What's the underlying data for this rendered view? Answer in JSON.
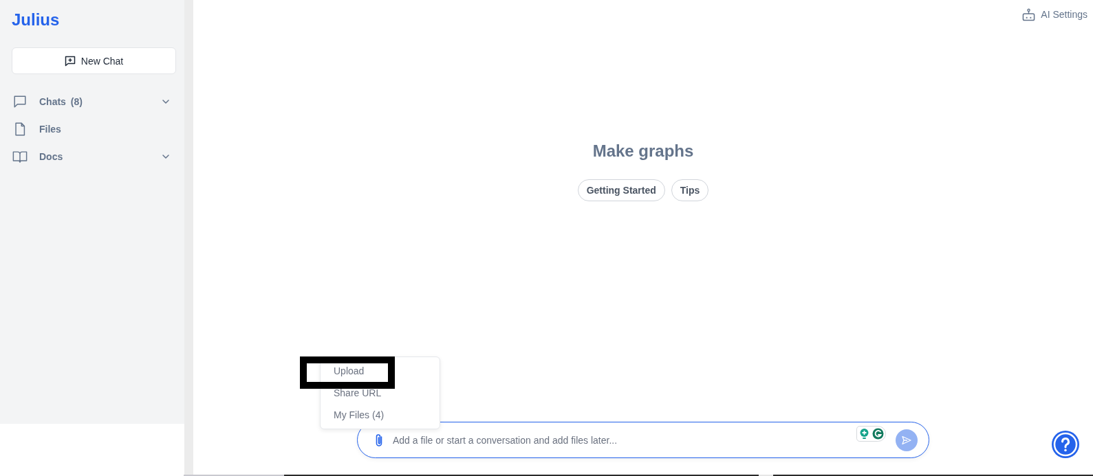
{
  "sidebar": {
    "brand": "Julius",
    "new_chat_button": {
      "label": "New Chat"
    },
    "items": [
      {
        "label": "Chats",
        "count": "(8)",
        "expandable": true
      },
      {
        "label": "Files",
        "expandable": false
      },
      {
        "label": "Docs",
        "expandable": true
      }
    ]
  },
  "header": {
    "settings_button": {
      "label": "AI Settings"
    }
  },
  "main": {
    "heading": "Make graphs",
    "suggestions": [
      {
        "label": "Getting Started"
      },
      {
        "label": "Tips"
      }
    ]
  },
  "attach_menu": {
    "items": [
      {
        "label": "Upload",
        "highlighted": true
      },
      {
        "label": "Share URL",
        "highlighted": false
      },
      {
        "label": "My Files (4)",
        "highlighted": false
      }
    ]
  },
  "composer": {
    "placeholder": "Add a file or start a conversation and add files later...",
    "send_disabled": true
  }
}
